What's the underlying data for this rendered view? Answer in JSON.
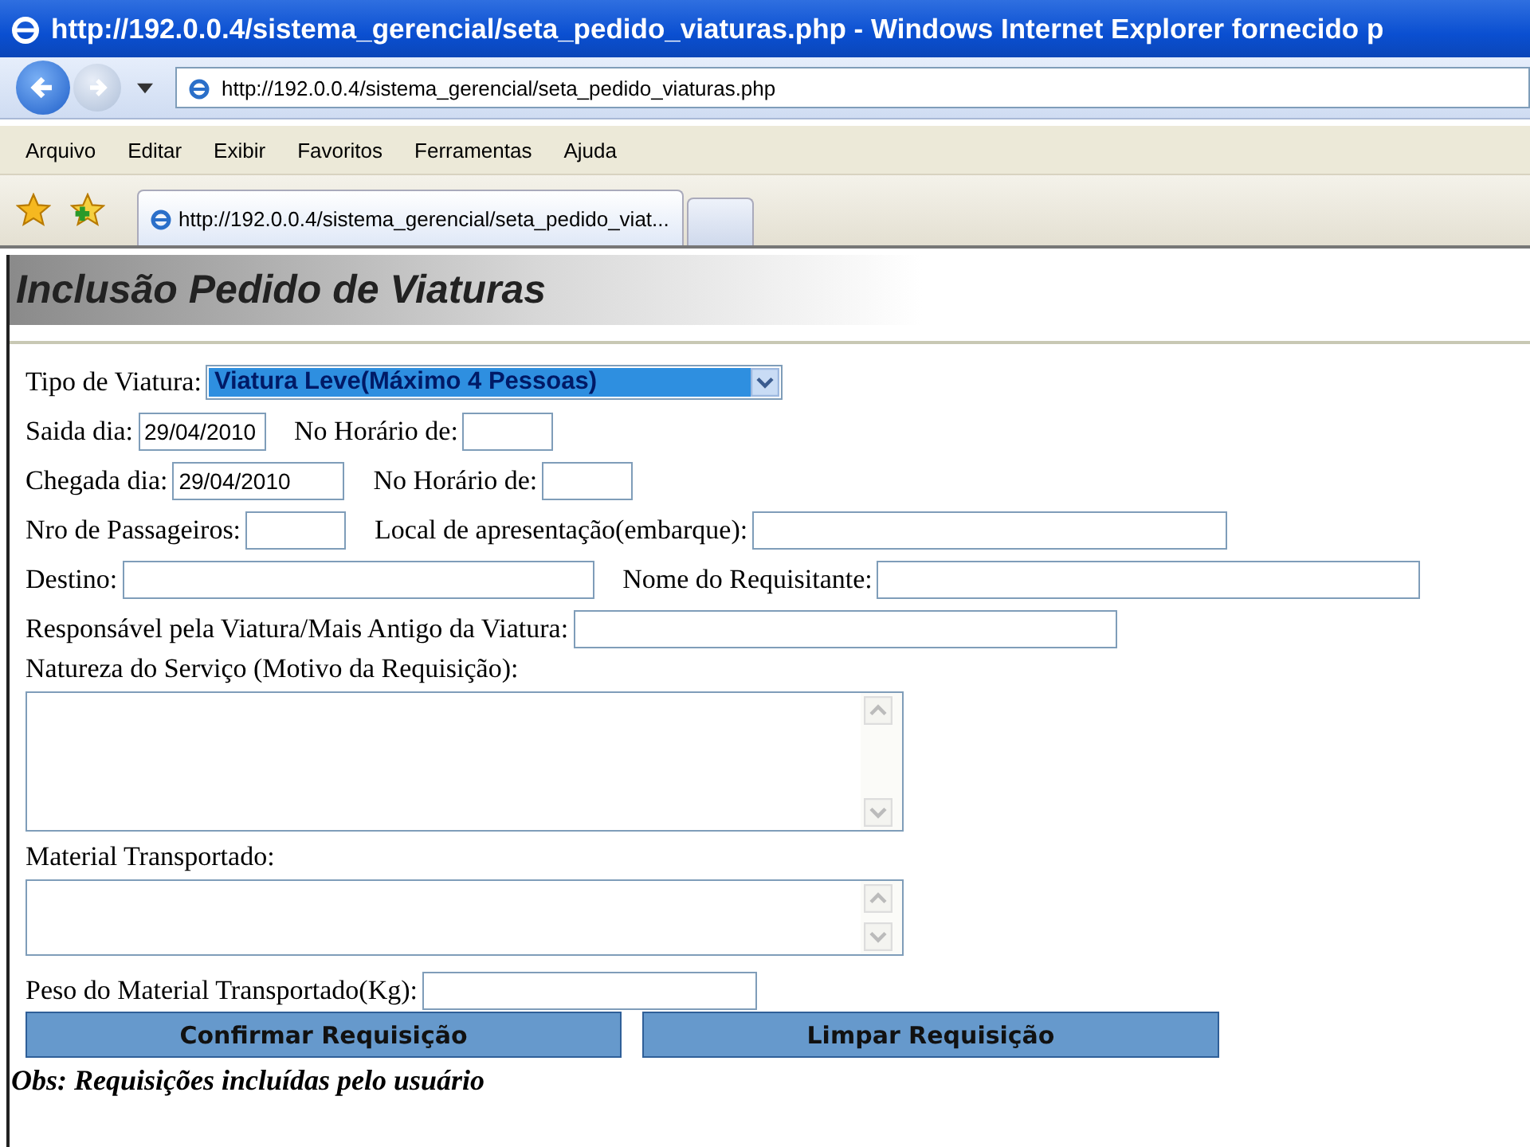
{
  "window": {
    "title": "http://192.0.0.4/sistema_gerencial/seta_pedido_viaturas.php - Windows Internet Explorer fornecido p"
  },
  "address_bar": {
    "url": "http://192.0.0.4/sistema_gerencial/seta_pedido_viaturas.php"
  },
  "menu": [
    "Arquivo",
    "Editar",
    "Exibir",
    "Favoritos",
    "Ferramentas",
    "Ajuda"
  ],
  "tabs": [
    {
      "label": "http://192.0.0.4/sistema_gerencial/seta_pedido_viat...",
      "selected": true
    }
  ],
  "page": {
    "heading": "Inclusão Pedido de Viaturas",
    "rows": [
      [
        {
          "label": "Tipo de Viatura:",
          "kind": "select",
          "value": "Viatura Leve(Máximo 4 Pessoas)",
          "focused": true
        }
      ],
      [
        {
          "label": "Saida dia:",
          "kind": "input",
          "value": "29/04/2010"
        },
        {
          "label": "No Horário de:",
          "kind": "input"
        }
      ],
      [
        {
          "label": "Chegada dia:",
          "kind": "input",
          "value": "29/04/2010"
        },
        {
          "label": "No Horário de:",
          "kind": "input"
        }
      ],
      [
        {
          "label": "Nro de Passageiros:",
          "kind": "input"
        },
        {
          "label": "Local de apresentação(embarque):",
          "kind": "input"
        }
      ],
      [
        {
          "label": "Destino:",
          "kind": "input"
        },
        {
          "label": "Nome do Requisitante:",
          "kind": "input"
        }
      ],
      [
        {
          "label": "Responsável pela Viatura/Mais Antigo da Viatura:",
          "kind": "input"
        }
      ],
      [
        {
          "label": "Natureza do Serviço (Motivo da Requisição):",
          "kind": "textarea"
        }
      ],
      [
        {
          "label": "Material Transportado:",
          "kind": "textarea"
        }
      ],
      [
        {
          "label": "Peso do Material Transportado(Kg):",
          "kind": "input"
        }
      ]
    ],
    "buttons": [
      "Confirmar Requisição",
      "Limpar Requisição"
    ],
    "note": "Obs: Requisições incluídas pelo usuário"
  }
}
